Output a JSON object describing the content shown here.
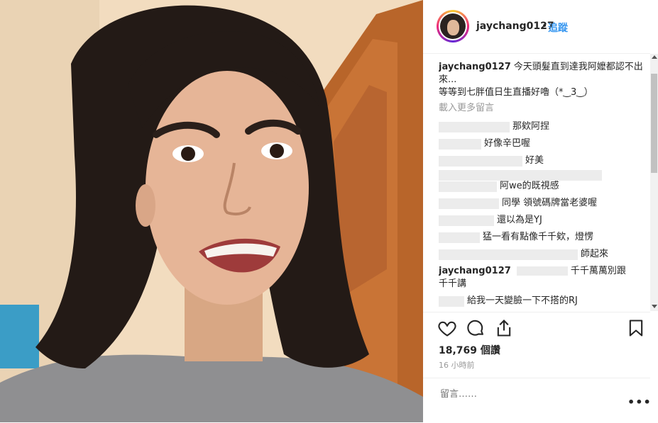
{
  "post": {
    "username": "jaychang0127",
    "dot": "•",
    "follow_label": "追蹤"
  },
  "caption": {
    "username": "jaychang0127",
    "text_line1": "今天頭髮直到達我阿嬤都認不出來...",
    "text_line2": "等等到七胖值日生直播好嚕（*‿3‿）"
  },
  "load_more": "載入更多留言",
  "comments": [
    {
      "text": "那欸阿捏"
    },
    {
      "text": "好像辛巴喔"
    },
    {
      "text": "好美"
    },
    {
      "text": "阿we的既視感"
    },
    {
      "text": "同學 領號碼牌當老婆喔"
    },
    {
      "text": "還以為是YJ"
    },
    {
      "text": "猛一看有點像千千欸，燈愣"
    },
    {
      "text": "師起來"
    }
  ],
  "reply": {
    "username": "jaychang0127",
    "text": "千千萬萬別跟千千講"
  },
  "partial_comment": "給我一天變臉一下不搭的RJ",
  "stats": {
    "views": "18,769 個讚",
    "time": "16 小時前"
  },
  "comment_placeholder": "留言……",
  "more_label": "•••",
  "icons": [
    "heart-icon",
    "comment-icon",
    "share-icon",
    "bookmark-icon"
  ]
}
